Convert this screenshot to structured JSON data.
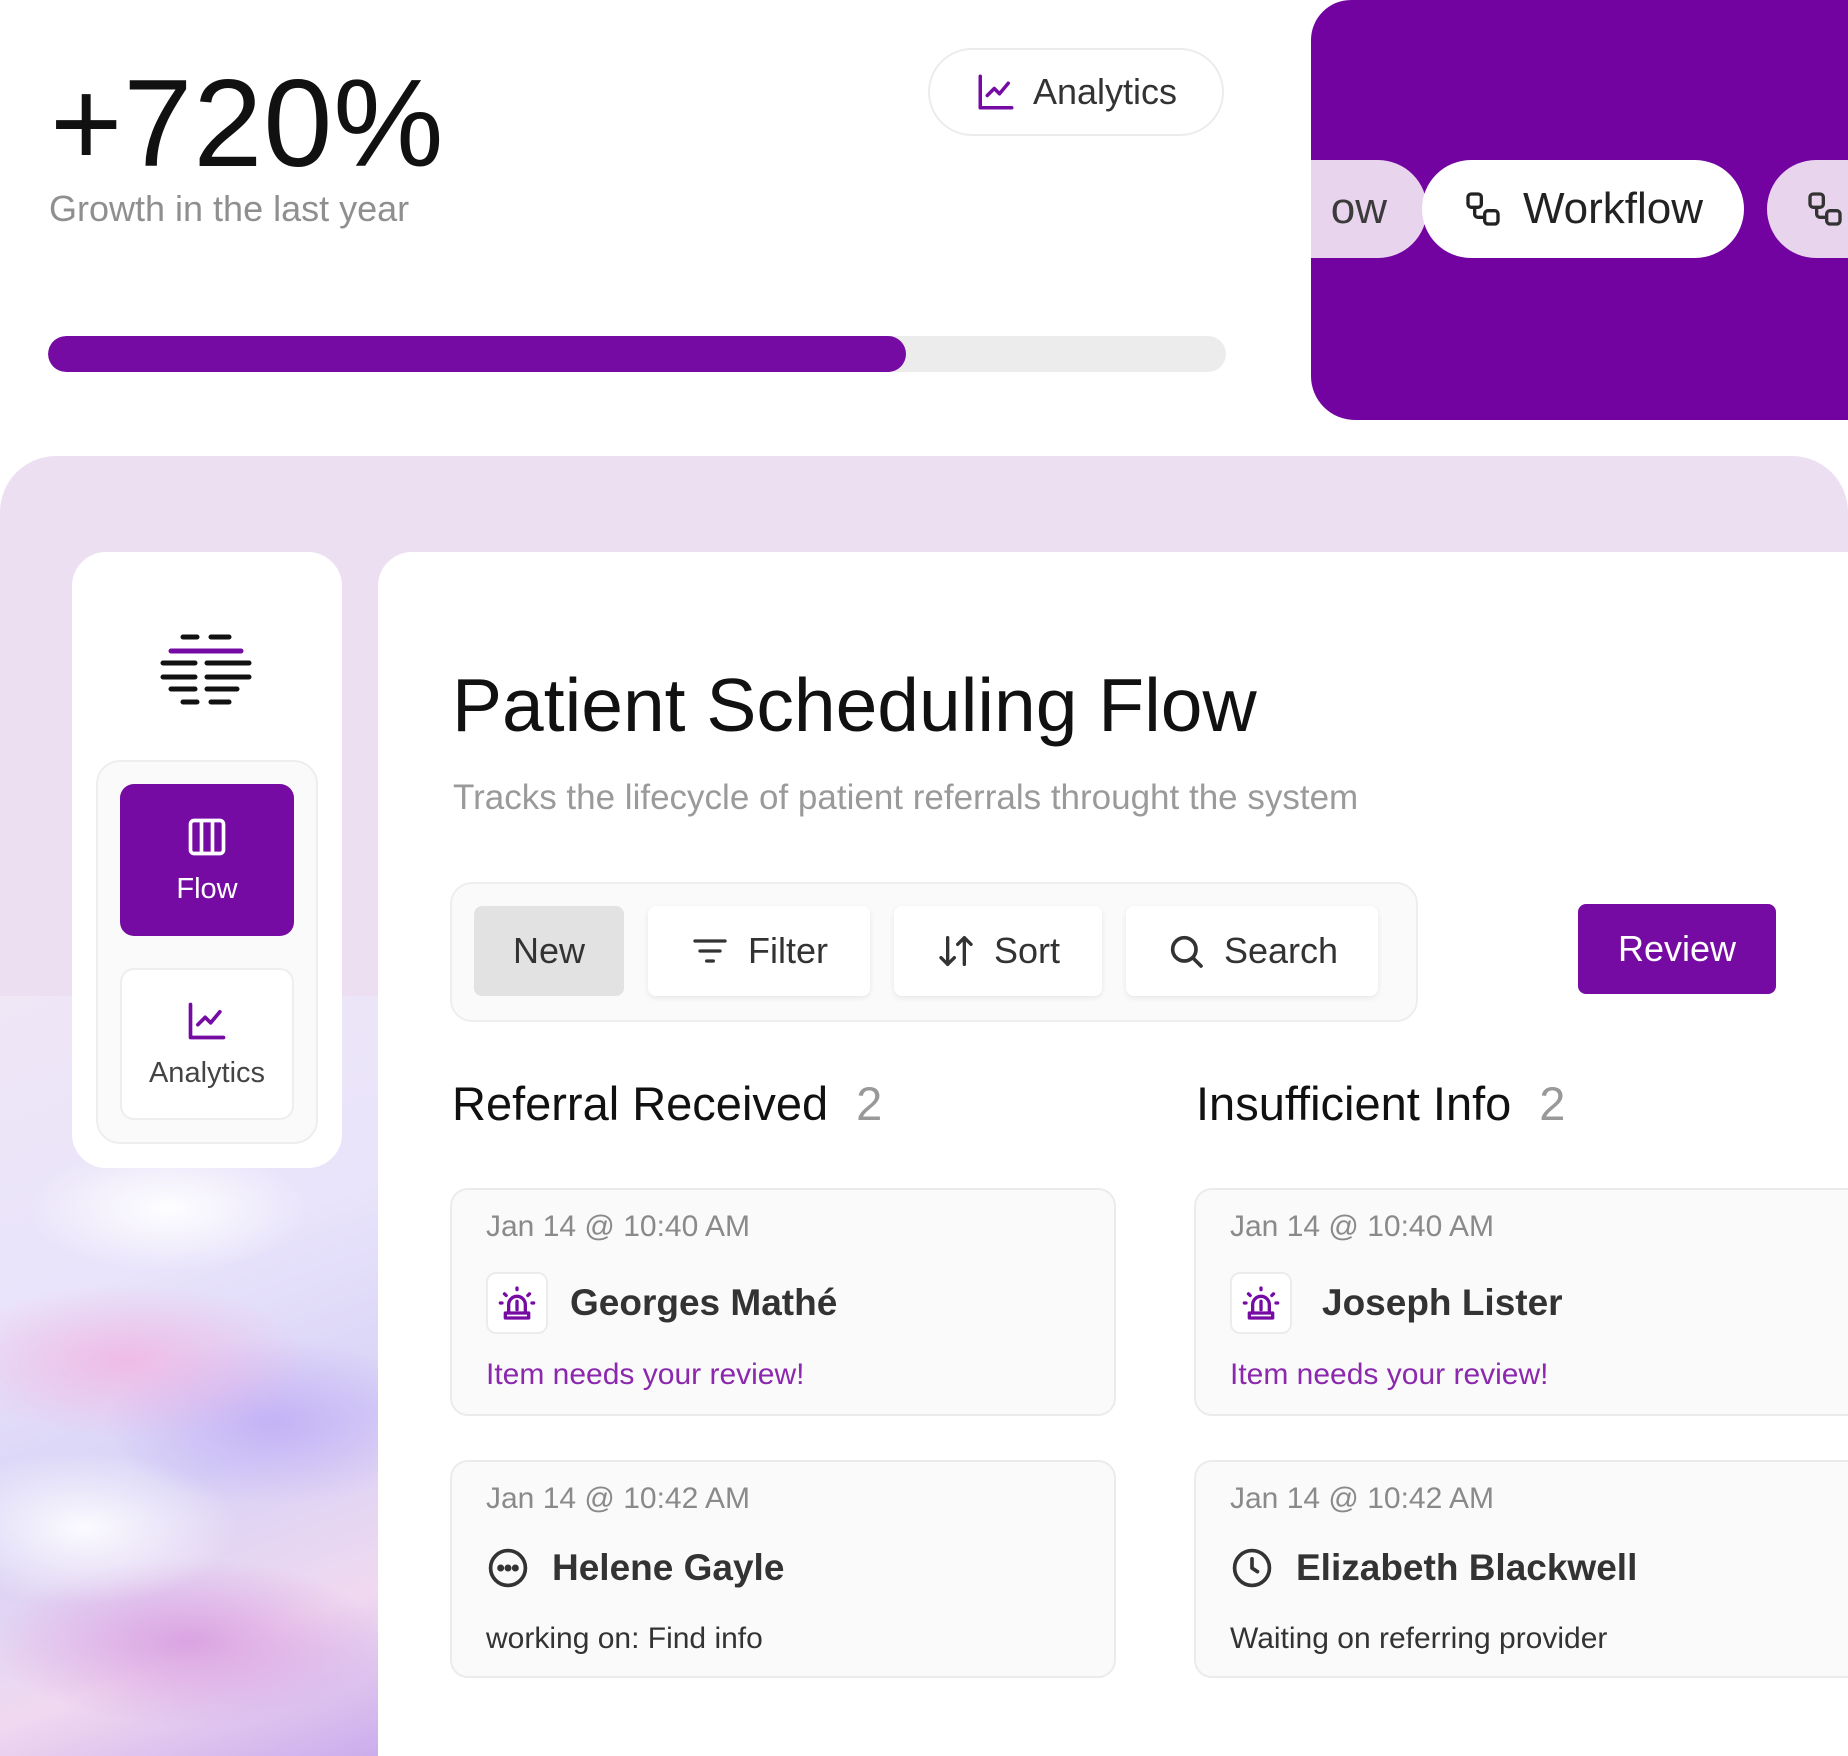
{
  "stats": {
    "value": "+720%",
    "caption": "Growth in the last year",
    "progress_fraction": 0.728
  },
  "analytics_chip": {
    "label": "Analytics",
    "icon": "chart-line-icon"
  },
  "workflow_card": {
    "pills": [
      {
        "label": "ow",
        "icon": "workflow-icon"
      },
      {
        "label": "Workflow",
        "icon": "workflow-icon"
      },
      {
        "label": "",
        "icon": "workflow-icon"
      }
    ]
  },
  "sidebar": {
    "logo": "app-logo",
    "items": [
      {
        "label": "Flow",
        "icon": "columns-icon",
        "active": true
      },
      {
        "label": "Analytics",
        "icon": "chart-line-icon",
        "active": false
      }
    ]
  },
  "main": {
    "title": "Patient Scheduling Flow",
    "subtitle": "Tracks the lifecycle of patient referrals throught the system",
    "toolbar": {
      "new_label": "New",
      "filter_label": "Filter",
      "sort_label": "Sort",
      "search_label": "Search"
    },
    "review_label": "Review",
    "columns": [
      {
        "title": "Referral Received",
        "count": "2",
        "cards": [
          {
            "time": "Jan 14 @ 10:40 AM",
            "name": "Georges Mathé",
            "icon": "siren-icon",
            "status": "Item needs your review!"
          },
          {
            "time": "Jan 14 @ 10:42 AM",
            "name": "Helene Gayle",
            "icon": "ellipsis-circle-icon",
            "status": "working on: Find info"
          }
        ]
      },
      {
        "title": "Insufficient Info",
        "count": "2",
        "cards": [
          {
            "time": "Jan 14 @ 10:40 AM",
            "name": "Joseph Lister",
            "icon": "siren-icon",
            "status": "Item needs your review!"
          },
          {
            "time": "Jan 14 @ 10:42 AM",
            "name": "Elizabeth Blackwell",
            "icon": "clock-icon",
            "status": "Waiting on referring provider"
          }
        ]
      }
    ]
  },
  "colors": {
    "brand": "#760ba4",
    "brand_dark": "#7303a1",
    "lavender": "#eddff2",
    "review_text": "#8b28ad"
  }
}
